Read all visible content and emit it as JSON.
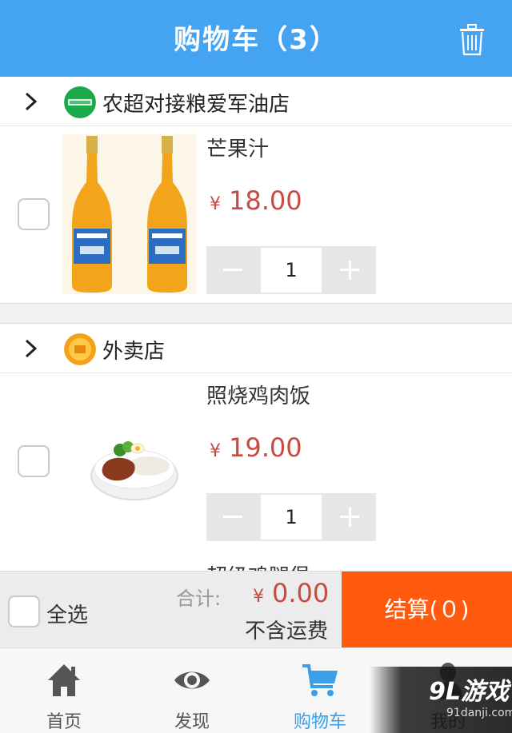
{
  "header": {
    "title": "购物车（3）",
    "trash_icon": "trash-icon"
  },
  "shops": [
    {
      "name": "农超对接粮爱军油店",
      "logo_color": "#1aa84b",
      "item": {
        "name": "芒果汁",
        "currency": "¥",
        "price": "18.00",
        "quantity": "1"
      }
    },
    {
      "name": "外卖店",
      "logo_color": "#f7a11a",
      "item": {
        "name": "照烧鸡肉饭",
        "currency": "¥",
        "price": "19.00",
        "quantity": "1"
      },
      "next_item_peek": "超级鸡腿堡"
    }
  ],
  "footer": {
    "select_all": "全选",
    "total_label": "合计:",
    "currency": "¥",
    "total": "0.00",
    "shipping_note": "不含运费",
    "checkout": "结算(０)"
  },
  "tabs": [
    {
      "label": "首页",
      "icon": "home-icon"
    },
    {
      "label": "发现",
      "icon": "eye-icon"
    },
    {
      "label": "购物车",
      "icon": "cart-icon",
      "active": true
    },
    {
      "label": "我的",
      "icon": "user-icon"
    }
  ],
  "watermark": {
    "brand": "9L游戏",
    "site": "91danji.com"
  },
  "colors": {
    "header": "#45a4f2",
    "price": "#c84b41",
    "checkout": "#ff5a0e",
    "active_tab": "#3a9ee8"
  }
}
